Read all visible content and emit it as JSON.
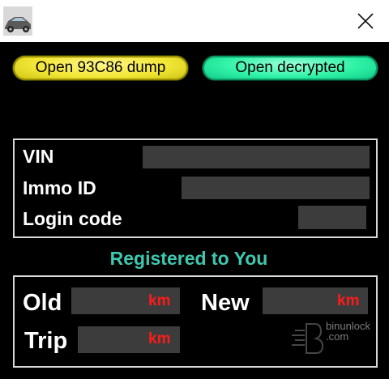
{
  "titlebar": {
    "icon": "car-icon",
    "close_icon": "close-icon"
  },
  "buttons": {
    "open_dump": "Open 93C86 dump",
    "open_decrypted": "Open decrypted"
  },
  "info": {
    "vin_label": "VIN",
    "vin_value": "",
    "immo_label": "Immo ID",
    "immo_value": "",
    "login_label": "Login code",
    "login_value": ""
  },
  "registered": "Registered to You",
  "odometer": {
    "old_label": "Old",
    "old_value": "",
    "new_label": "New",
    "new_value": "",
    "trip_label": "Trip",
    "trip_value": "",
    "unit": "km"
  },
  "watermark": {
    "line1": "binunlock",
    "line2": ".com"
  },
  "colors": {
    "background": "#000000",
    "yellow_button": "#f2e635",
    "green_button": "#2ef2a6",
    "registered_text": "#3ec8b0",
    "unit_text": "#ff1a1a",
    "field_bg": "#3c3c3c"
  }
}
